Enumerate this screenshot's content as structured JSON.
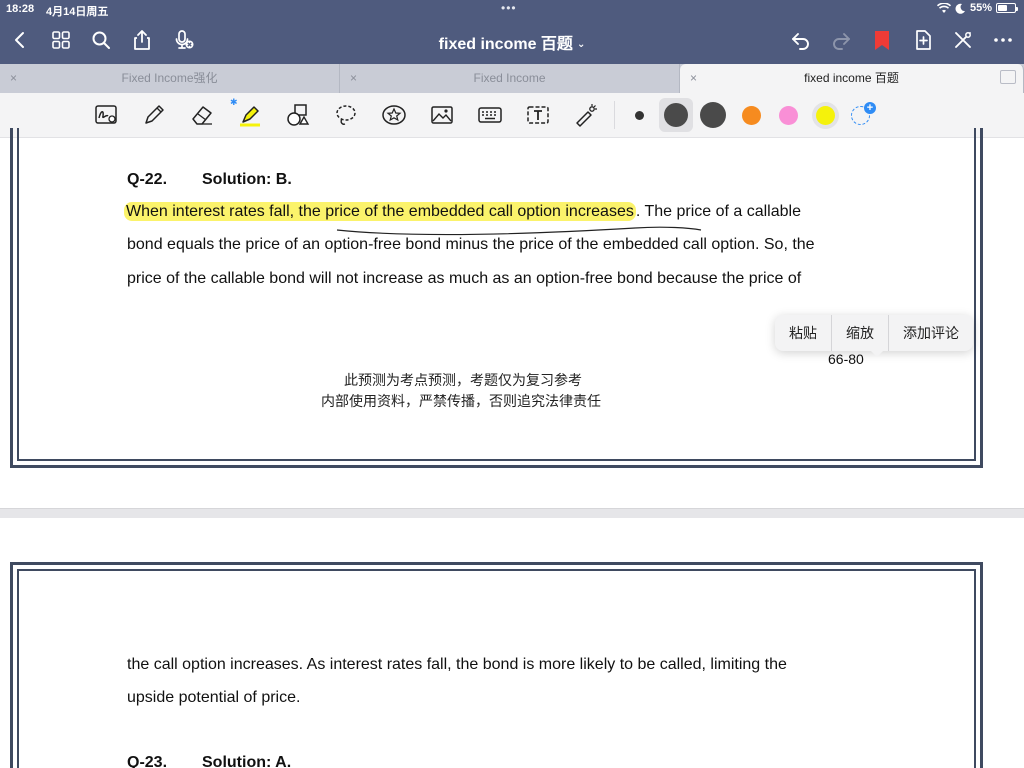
{
  "status": {
    "time": "18:28",
    "date": "4月14日周五",
    "battery": "55%"
  },
  "nav": {
    "title": "fixed income 百题",
    "title_chevron": "⌄"
  },
  "tabs": [
    {
      "label": "Fixed Income强化"
    },
    {
      "label": "Fixed Income"
    },
    {
      "label": "fixed income 百题"
    }
  ],
  "toolbar": {
    "colors": {
      "black": "#333333",
      "dark_gray": "#4a4a4a",
      "orange": "#f68b1f",
      "pink": "#f98fd6",
      "yellow": "#f5f20b"
    },
    "tools": [
      "handwriting-icon",
      "pen-icon",
      "eraser-icon",
      "highlighter-icon",
      "shapes-icon",
      "lasso-icon",
      "sticker-icon",
      "image-icon",
      "keyboard-icon",
      "text-box-icon",
      "laser-pointer-icon"
    ]
  },
  "page1": {
    "question": "Q-22.",
    "solution": "Solution: B.",
    "highlighted_text": "When interest rates fall, the price of the embedded call option increases",
    "line1_rest": ". The price of a callable",
    "line2": "bond equals the price of an option-free bond minus the price of the embedded call option. So, the",
    "line3": "price of the callable bond will not increase as much as an option-free bond because the price of",
    "page_number": "66-80",
    "footer_line1": "此预测为考点预测，考题仅为复习参考",
    "footer_line2": "内部使用资料，严禁传播，否则追究法律责任"
  },
  "context_menu": {
    "items": [
      "粘贴",
      "缩放",
      "添加评论"
    ]
  },
  "page2": {
    "line1": "the call option increases. As interest rates fall, the bond is more likely to be called, limiting the",
    "line2": "upside potential of price.",
    "question": "Q-23.",
    "solution": "Solution: A."
  }
}
